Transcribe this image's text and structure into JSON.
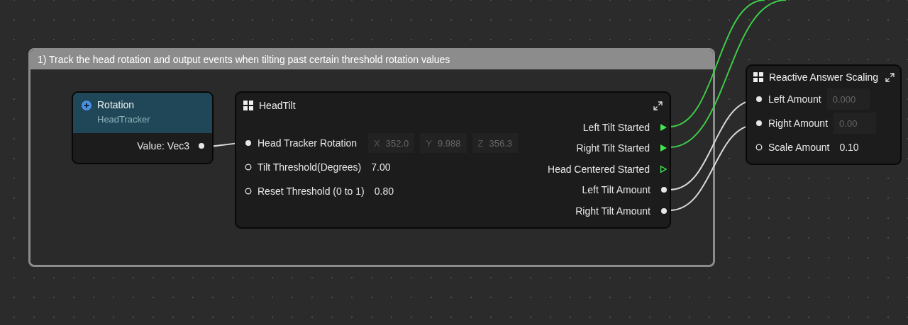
{
  "comment": {
    "title": "1) Track the head rotation and output events when tilting past certain threshold rotation values"
  },
  "rotation_node": {
    "title": "Rotation",
    "subtitle": "HeadTracker",
    "outputs": [
      {
        "label": "Value: Vec3",
        "connected": true
      }
    ]
  },
  "head_tilt_node": {
    "title": "HeadTilt",
    "inputs": [
      {
        "label": "Head Tracker Rotation",
        "connected": true,
        "kind": "vector",
        "fields": [
          {
            "axis": "X",
            "value": "352.0"
          },
          {
            "axis": "Y",
            "value": "9.988"
          },
          {
            "axis": "Z",
            "value": "356.3"
          }
        ]
      },
      {
        "label": "Tilt Threshold(Degrees)",
        "connected": false,
        "kind": "value",
        "value": "7.00"
      },
      {
        "label": "Reset Threshold (0 to 1)",
        "connected": false,
        "kind": "value",
        "value": "0.80"
      }
    ],
    "outputs": [
      {
        "label": "Left Tilt Started",
        "kind": "event",
        "connected": true
      },
      {
        "label": "Right Tilt Started",
        "kind": "event",
        "connected": true
      },
      {
        "label": "Head Centered Started",
        "kind": "event",
        "connected": false
      },
      {
        "label": "Left Tilt Amount",
        "kind": "value",
        "connected": true
      },
      {
        "label": "Right Tilt Amount",
        "kind": "value",
        "connected": true
      }
    ]
  },
  "reactive_node": {
    "title": "Reactive Answer Scaling",
    "inputs": [
      {
        "label": "Left Amount",
        "connected": true,
        "kind": "field",
        "value": "0.000"
      },
      {
        "label": "Right Amount",
        "connected": true,
        "kind": "field",
        "value": "0.00"
      },
      {
        "label": "Scale Amount",
        "connected": false,
        "kind": "value",
        "value": "0.10"
      }
    ]
  }
}
